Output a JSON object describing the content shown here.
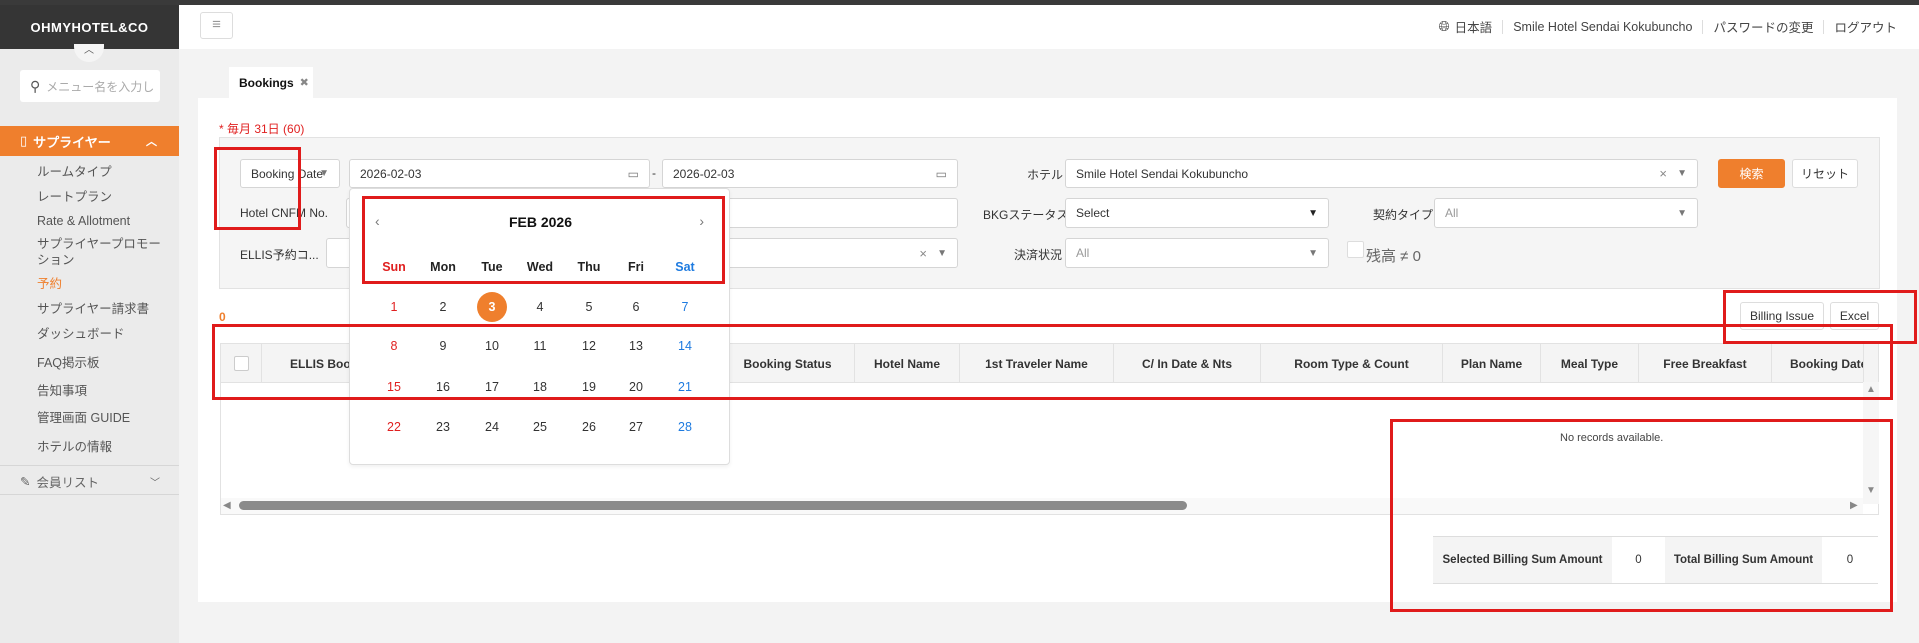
{
  "app": {
    "logo": "OHMYHOTEL&CO"
  },
  "header": {
    "language": "日本語",
    "hotel": "Smile Hotel Sendai Kokubuncho",
    "change_password": "パスワードの変更",
    "logout": "ログアウト"
  },
  "sidebar": {
    "search_placeholder": "メニュー名を入力し",
    "section": "サプライヤー",
    "items": [
      {
        "label": "ルームタイプ"
      },
      {
        "label": "レートプラン"
      },
      {
        "label": "Rate & Allotment"
      },
      {
        "label": "サプライヤープロモーション"
      },
      {
        "label": "予約"
      },
      {
        "label": "サプライヤー請求書"
      },
      {
        "label": "ダッシュボード"
      },
      {
        "label": "FAQ掲示板"
      },
      {
        "label": "告知事項"
      },
      {
        "label": "管理画面 GUIDE"
      },
      {
        "label": "ホテルの情報"
      }
    ],
    "section2": "会員リスト"
  },
  "tab": {
    "label": "Bookings"
  },
  "note": "* 毎月 31日 (60)",
  "filters": {
    "date_type": "Booking Date",
    "date_from": "2026-02-03",
    "date_sep": "-",
    "date_to": "2026-02-03",
    "hotel_label": "ホテル",
    "hotel_value": "Smile Hotel Sendai Kokubuncho",
    "cnfm_label": "Hotel CNFM No.",
    "bkg_status_label": "BKGステータス",
    "bkg_status_value": "Select",
    "contract_label": "契約タイプ",
    "contract_value": "All",
    "ellis_label": "ELLIS予約コ...",
    "payment_label": "決済状況",
    "payment_value": "All",
    "balance_label": "残高 ≠ 0",
    "search_btn": "検索",
    "reset_btn": "リセット"
  },
  "calendar": {
    "title": "FEB 2026",
    "weekdays": [
      "Sun",
      "Mon",
      "Tue",
      "Wed",
      "Thu",
      "Fri",
      "Sat"
    ],
    "weeks": [
      [
        "1",
        "2",
        "3",
        "4",
        "5",
        "6",
        "7"
      ],
      [
        "8",
        "9",
        "10",
        "11",
        "12",
        "13",
        "14"
      ],
      [
        "15",
        "16",
        "17",
        "18",
        "19",
        "20",
        "21"
      ],
      [
        "22",
        "23",
        "24",
        "25",
        "26",
        "27",
        "28"
      ]
    ],
    "selected": "3"
  },
  "results": {
    "count": "0",
    "billing_issue_btn": "Billing Issue",
    "excel_btn": "Excel",
    "empty": "No records available."
  },
  "table": {
    "columns": [
      "ELLIS Booki",
      "Booking Status",
      "Hotel Name",
      "1st Traveler Name",
      "C/ In Date & Nts",
      "Room Type & Count",
      "Plan Name",
      "Meal Type",
      "Free Breakfast",
      "Booking Date"
    ]
  },
  "summary": {
    "selected_label": "Selected Billing Sum Amount",
    "selected_value": "0",
    "total_label": "Total Billing Sum Amount",
    "total_value": "0"
  },
  "colors": {
    "accent": "#ef7f2d",
    "sunday": "#e02020",
    "saturday": "#1e7be0",
    "annotation": "#e01b1b"
  }
}
